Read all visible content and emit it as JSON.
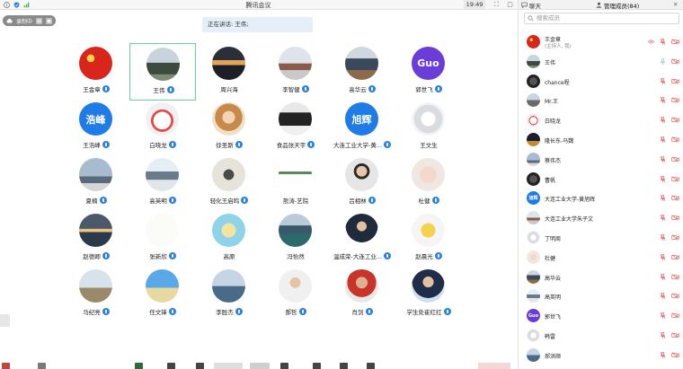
{
  "window": {
    "title": "腾讯会议",
    "time": "19:49"
  },
  "recording": {
    "label": "录制中"
  },
  "speaking": {
    "text": "正在讲话: 王伟;"
  },
  "colors": {
    "mic_blue": "#2a82e4",
    "active_border": "#69d29b",
    "muted_red": "#e06a6a",
    "mic_gray": "#9ec9b5"
  },
  "participants": [
    {
      "name": "王金章",
      "avatar": "flag-red",
      "mic": true
    },
    {
      "name": "王伟",
      "avatar": "photo-building",
      "mic": true,
      "active": true
    },
    {
      "name": "周兴海",
      "avatar": "photo-sunset",
      "mic": false
    },
    {
      "name": "李智健",
      "avatar": "photo-pavilion",
      "mic": true
    },
    {
      "name": "高华云",
      "avatar": "photo-street",
      "mic": true
    },
    {
      "name": "郭世飞",
      "avatar_text": "Guo",
      "avatar_color": "#6a3cd8",
      "mic": true
    },
    {
      "name": "王浩峰",
      "avatar_text": "浩峰",
      "avatar_color": "#1f7ce6",
      "mic": true
    },
    {
      "name": "白晓龙",
      "avatar": "photo-cartoon",
      "mic": true
    },
    {
      "name": "徐圣斯",
      "avatar": "photo-girl",
      "mic": true
    },
    {
      "name": "食品张天宇",
      "avatar": "photo-car",
      "mic": true
    },
    {
      "name": "大连工业大学-黄...",
      "avatar_text": "旭辉",
      "avatar_color": "#1f7ce6",
      "mic": true
    },
    {
      "name": "王文生",
      "avatar": "photo-white",
      "mic": false
    },
    {
      "name": "夏楠",
      "avatar": "photo-sky",
      "mic": true
    },
    {
      "name": "高英明",
      "avatar": "photo-roof",
      "mic": true
    },
    {
      "name": "轻化王启鸣",
      "avatar": "photo-cat",
      "mic": true
    },
    {
      "name": "熊涛-艺院",
      "avatar": "photo-text",
      "mic": false
    },
    {
      "name": "吕相林",
      "avatar": "photo-man",
      "mic": true
    },
    {
      "name": "杜健",
      "avatar": "photo-baby",
      "mic": true
    },
    {
      "name": "赵德卿",
      "avatar": "photo-beach",
      "mic": true
    },
    {
      "name": "张新欣",
      "avatar": "photo-calligraphy",
      "mic": true
    },
    {
      "name": "高原",
      "avatar": "photo-cartoon2",
      "mic": false
    },
    {
      "name": "冯怡然",
      "avatar": "photo-lake",
      "mic": false
    },
    {
      "name": "温成荣-大连工业...",
      "avatar": "photo-suit",
      "mic": true
    },
    {
      "name": "赵晨光",
      "avatar": "photo-anime",
      "mic": true
    },
    {
      "name": "马纪亮",
      "avatar": "photo-field",
      "mic": true
    },
    {
      "name": "任文锋",
      "avatar": "photo-sea",
      "mic": true
    },
    {
      "name": "李胜杰",
      "avatar": "photo-coast",
      "mic": true
    },
    {
      "name": "郝哲",
      "avatar": "photo-person",
      "mic": true
    },
    {
      "name": "肖剑",
      "avatar": "photo-boy",
      "mic": true
    },
    {
      "name": "学生处崔红红",
      "avatar": "photo-man2",
      "mic": true
    }
  ],
  "panel": {
    "tab_chat": "聊天",
    "tab_members": "管理成员(84)",
    "search_placeholder": "搜索成员",
    "members": [
      {
        "name": "王金章",
        "sub": "(主持人, 我)",
        "avatar": "flag-red",
        "eye": true,
        "mic": "muted",
        "cam": "off"
      },
      {
        "name": "王伟",
        "avatar": "photo-building",
        "mic": "on",
        "cam": "off"
      },
      {
        "name": "chance程",
        "avatar": "photo-dark",
        "mic": "muted",
        "cam": "off"
      },
      {
        "name": "Mr.王",
        "avatar": "photo-road",
        "mic": "muted",
        "cam": "off"
      },
      {
        "name": "白晓龙",
        "avatar": "photo-cartoon",
        "mic": "muted",
        "cam": "off"
      },
      {
        "name": "隆长东-马魏",
        "avatar": "photo-night",
        "mic": "muted",
        "cam": "off"
      },
      {
        "name": "蔡伟杰",
        "avatar": "photo-sky",
        "mic": "muted",
        "cam": "off"
      },
      {
        "name": "曹帆",
        "avatar": "photo-dark",
        "mic": "muted",
        "cam": "off"
      },
      {
        "name": "大连工业大学-黄旭辉",
        "avatar_text": "旭辉",
        "avatar_color": "#1f7ce6",
        "mic": "muted",
        "cam": "off"
      },
      {
        "name": "大连工业大学朱子文",
        "avatar": "photo-pavilion",
        "mic": "muted",
        "cam": "off"
      },
      {
        "name": "丁明周",
        "avatar": "photo-white",
        "mic": "muted",
        "cam": "off"
      },
      {
        "name": "杜健",
        "avatar": "photo-baby",
        "mic": "muted",
        "cam": "off"
      },
      {
        "name": "高华云",
        "avatar": "photo-street",
        "mic": "muted",
        "cam": "off"
      },
      {
        "name": "高英明",
        "avatar": "photo-roof",
        "mic": "muted",
        "cam": "off"
      },
      {
        "name": "郭世飞",
        "avatar_text": "Guo",
        "avatar_color": "#6a3cd8",
        "mic": "muted",
        "cam": "off"
      },
      {
        "name": "韩雷",
        "avatar": "photo-white",
        "mic": "muted",
        "cam": "off"
      },
      {
        "name": "郝洪顺",
        "avatar": "photo-coast",
        "mic": "muted",
        "cam": "off"
      }
    ]
  }
}
